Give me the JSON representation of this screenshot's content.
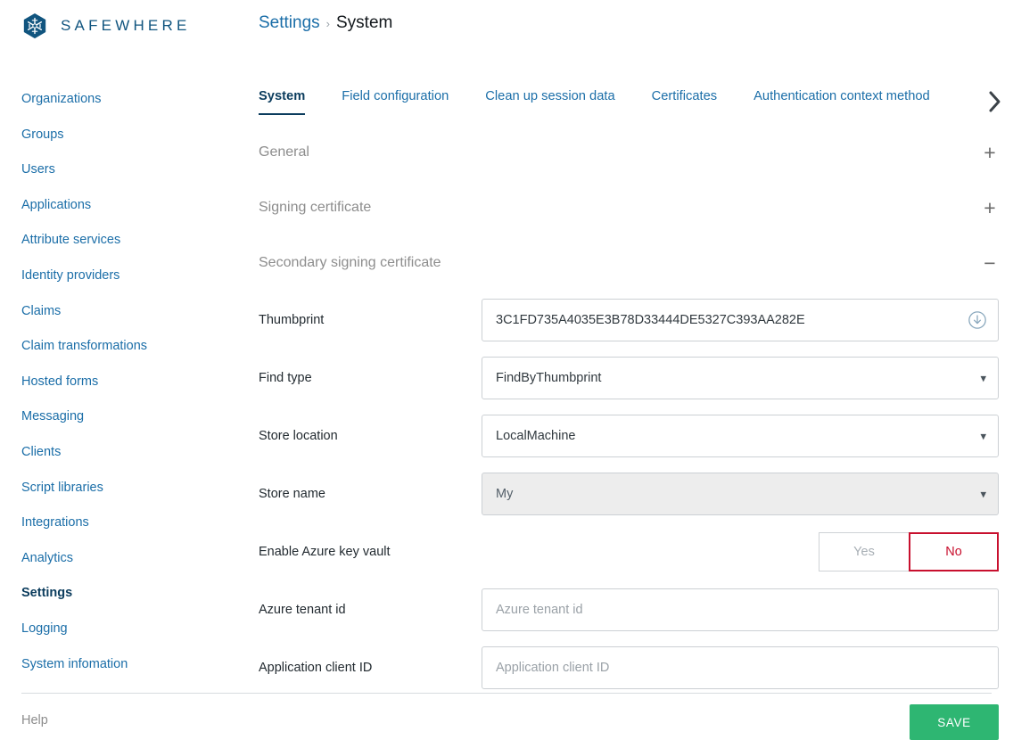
{
  "brand": {
    "name": "SAFEWHERE",
    "logo_icon": "snowflake-hexagon-logo",
    "logo_color": "#11557f"
  },
  "breadcrumb": {
    "parent": "Settings",
    "separator": "›",
    "current": "System"
  },
  "sidebar": {
    "items": [
      {
        "label": "Organizations",
        "active": false
      },
      {
        "label": "Groups",
        "active": false
      },
      {
        "label": "Users",
        "active": false
      },
      {
        "label": "Applications",
        "active": false
      },
      {
        "label": "Attribute services",
        "active": false
      },
      {
        "label": "Identity providers",
        "active": false
      },
      {
        "label": "Claims",
        "active": false
      },
      {
        "label": "Claim transformations",
        "active": false
      },
      {
        "label": "Hosted forms",
        "active": false
      },
      {
        "label": "Messaging",
        "active": false
      },
      {
        "label": "Clients",
        "active": false
      },
      {
        "label": "Script libraries",
        "active": false
      },
      {
        "label": "Integrations",
        "active": false
      },
      {
        "label": "Analytics",
        "active": false
      },
      {
        "label": "Settings",
        "active": true
      },
      {
        "label": "Logging",
        "active": false
      },
      {
        "label": "System infomation",
        "active": false
      }
    ]
  },
  "tabs": {
    "items": [
      {
        "label": "System",
        "active": true
      },
      {
        "label": "Field configuration",
        "active": false
      },
      {
        "label": "Clean up session data",
        "active": false
      },
      {
        "label": "Certificates",
        "active": false
      },
      {
        "label": "Authentication context method",
        "active": false
      }
    ],
    "scroll_next_icon": "chevron-right-icon"
  },
  "sections": [
    {
      "title": "General",
      "expanded": false,
      "toggle": "+"
    },
    {
      "title": "Signing certificate",
      "expanded": false,
      "toggle": "+"
    },
    {
      "title": "Secondary signing certificate",
      "expanded": true,
      "toggle": "−"
    }
  ],
  "form": {
    "thumbprint": {
      "label": "Thumbprint",
      "value": "3C1FD735A4035E3B78D33444DE5327C393AA282E",
      "placeholder": "Thumbprint",
      "action_icon": "download-circle-icon"
    },
    "find_type": {
      "label": "Find type",
      "value": "FindByThumbprint",
      "caret_icon": "chevron-down-icon"
    },
    "store_location": {
      "label": "Store location",
      "value": "LocalMachine",
      "caret_icon": "chevron-down-icon"
    },
    "store_name": {
      "label": "Store name",
      "value": "My",
      "disabled": true,
      "caret_icon": "chevron-down-icon"
    },
    "enable_azure_key_vault": {
      "label": "Enable Azure key vault",
      "yes_label": "Yes",
      "no_label": "No",
      "selected": "No",
      "selected_color": "#c8102e"
    },
    "azure_tenant_id": {
      "label": "Azure tenant id",
      "value": "",
      "placeholder": "Azure tenant id"
    },
    "application_client_id": {
      "label": "Application client ID",
      "value": "",
      "placeholder": "Application client ID"
    }
  },
  "footer": {
    "help_label": "Help",
    "save_label": "SAVE",
    "save_color": "#2eb672"
  }
}
